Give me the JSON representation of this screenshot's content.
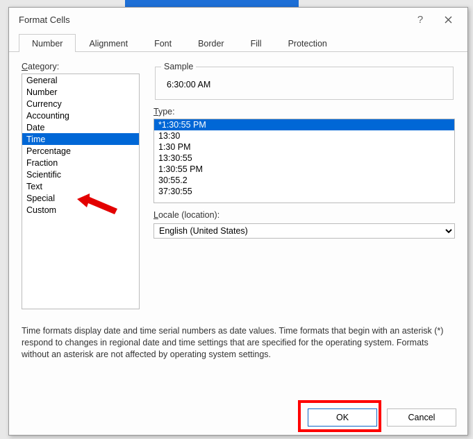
{
  "title": "Format Cells",
  "tabs": [
    "Number",
    "Alignment",
    "Font",
    "Border",
    "Fill",
    "Protection"
  ],
  "active_tab_index": 0,
  "category_label": "Category:",
  "categories": [
    "General",
    "Number",
    "Currency",
    "Accounting",
    "Date",
    "Time",
    "Percentage",
    "Fraction",
    "Scientific",
    "Text",
    "Special",
    "Custom"
  ],
  "selected_category_index": 5,
  "sample_label": "Sample",
  "sample_value": "6:30:00 AM",
  "type_label": "Type:",
  "types": [
    "*1:30:55 PM",
    "13:30",
    "1:30 PM",
    "13:30:55",
    "1:30:55 PM",
    "30:55.2",
    "37:30:55"
  ],
  "selected_type_index": 0,
  "locale_label": "Locale (location):",
  "locale_value": "English (United States)",
  "description": "Time formats display date and time serial numbers as date values.  Time formats that begin with an asterisk (*) respond to changes in regional date and time settings that are specified for the operating system.  Formats without an asterisk are not affected by operating system settings.",
  "ok_label": "OK",
  "cancel_label": "Cancel"
}
